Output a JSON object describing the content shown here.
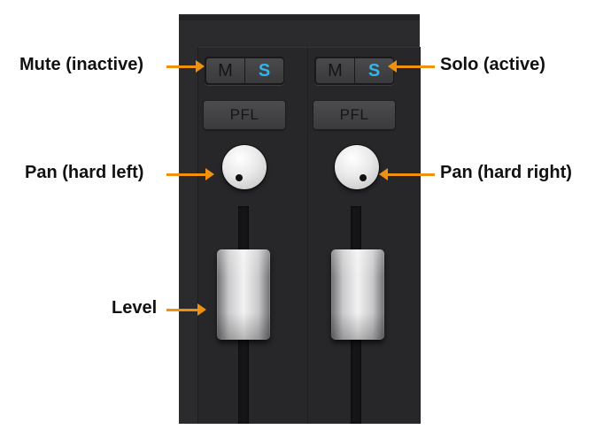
{
  "colors": {
    "background": "#ffffff",
    "mixer_panel": "#2b2b2d",
    "strip": "#27272a",
    "solo_active": "#2fb6ec",
    "callout_arrow": "#f0900f",
    "fader_track": "#151517"
  },
  "channels": [
    {
      "mute_label": "M",
      "solo_label": "S",
      "pfl_label": "PFL",
      "solo_active": true,
      "mute_active": false,
      "pan": "hard left"
    },
    {
      "mute_label": "M",
      "solo_label": "S",
      "pfl_label": "PFL",
      "solo_active": true,
      "mute_active": false,
      "pan": "hard right"
    }
  ],
  "callouts": {
    "mute": "Mute (inactive)",
    "solo": "Solo (active)",
    "pan_left": "Pan (hard left)",
    "pan_right": "Pan (hard right)",
    "level": "Level"
  }
}
